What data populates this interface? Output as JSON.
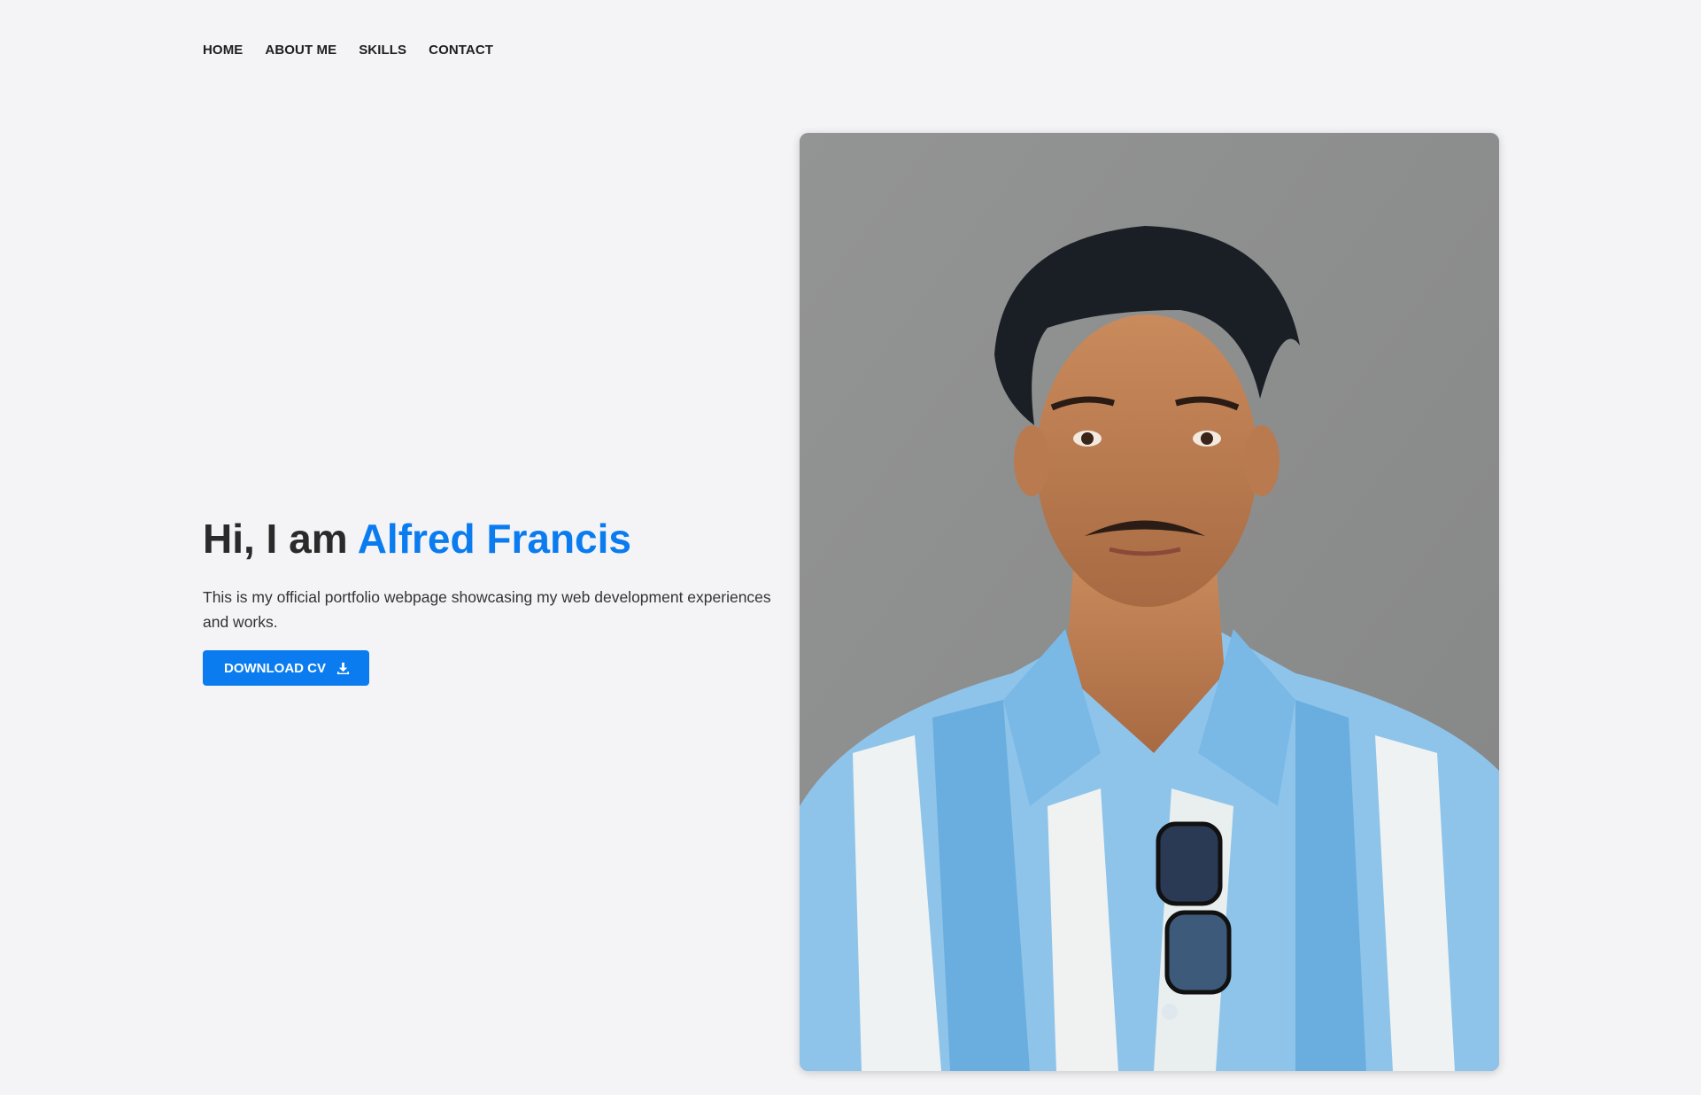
{
  "nav": {
    "items": [
      {
        "label": "HOME"
      },
      {
        "label": "ABOUT ME"
      },
      {
        "label": "SKILLS"
      },
      {
        "label": "CONTACT"
      }
    ]
  },
  "hero": {
    "greeting": "Hi, I am ",
    "name": "Alfred Francis",
    "description": "This is my official portfolio webpage showcasing my web development experiences and works.",
    "cv_button_label": "DOWNLOAD CV",
    "cv_button_icon": "download-icon"
  },
  "colors": {
    "accent": "#0a7cf0",
    "background": "#f4f4f7",
    "text": "#2a2a2a"
  }
}
